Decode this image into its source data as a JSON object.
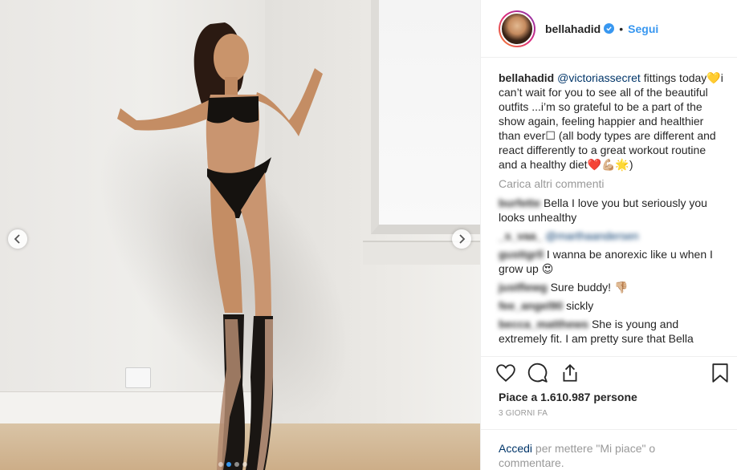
{
  "post": {
    "username": "bellahadid",
    "follow_label": "Segui",
    "separator": "•",
    "caption": {
      "author": "bellahadid",
      "mention": "@victoriassecret",
      "text": " fittings today💛i can’t wait for you to see all of the beautiful outfits ...i’m so grateful to be a part of the show again, feeling happier and healthier than ever☐ (all body types are different and react differently to a great workout routine and a healthy diet❤️💪🏼🌟)"
    },
    "load_more_label": "Carica altri commenti",
    "comments": [
      {
        "user": "burfette",
        "text": "Bella I love you but seriously you looks unhealthy"
      },
      {
        "user": "_s_vaa_",
        "text": "",
        "mention": "@marthaandersen"
      },
      {
        "user": "gusttgrll",
        "text": "I wanna be anorexic like u when I grow up 😍"
      },
      {
        "user": "justflewg",
        "text": "Sure buddy! 👎🏼"
      },
      {
        "user": "fee_angel90",
        "text": "sickly"
      },
      {
        "user": "becca_matthews",
        "text": "She is young and extremely fit. I am pretty sure that Bella"
      }
    ],
    "likes_text": "Piace a 1.610.987 persone",
    "timestamp": "3 GIORNI FA",
    "login_link": "Accedi",
    "login_text": " per mettere \"Mi piace\" o commentare."
  },
  "carousel": {
    "slide_count": 4,
    "active_slide": 1
  },
  "icons": {
    "like": "heart-icon",
    "comment": "comment-icon",
    "share": "share-icon",
    "save": "bookmark-icon",
    "prev": "chevron-left-icon",
    "next": "chevron-right-icon",
    "verified": "verified-badge-icon"
  },
  "colors": {
    "accent": "#3897f0",
    "text": "#262626",
    "muted": "#999999",
    "link": "#003569"
  }
}
